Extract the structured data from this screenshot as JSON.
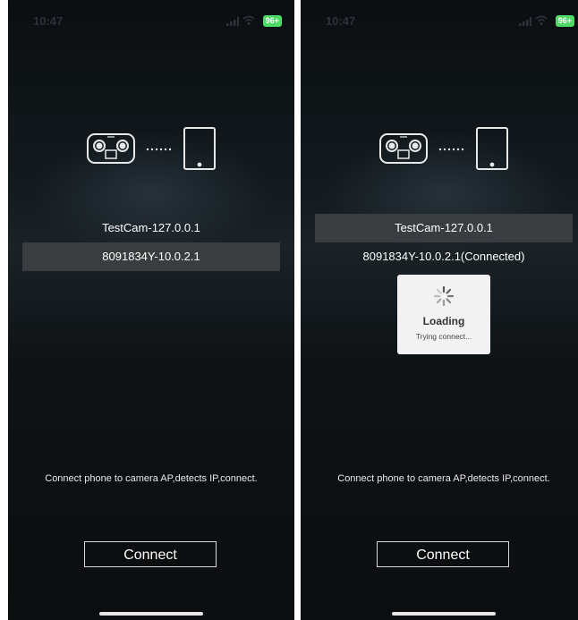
{
  "left_screen": {
    "status": {
      "time": "10:47",
      "battery": "96+"
    },
    "devices": [
      {
        "label": "TestCam-127.0.0.1",
        "selected": false
      },
      {
        "label": "8091834Y-10.0.2.1",
        "selected": true
      }
    ],
    "hint": "Connect phone to camera AP,detects IP,connect.",
    "connect_label": "Connect"
  },
  "right_screen": {
    "status": {
      "time": "10:47",
      "battery": "96+"
    },
    "devices": [
      {
        "label": "TestCam-127.0.0.1",
        "selected": true
      },
      {
        "label": "8091834Y-10.0.2.1(Connected)",
        "selected": false
      }
    ],
    "loading": {
      "title": "Loading",
      "subtitle": "Trying connect..."
    },
    "hint": "Connect phone to camera AP,detects IP,connect.",
    "connect_label": "Connect"
  },
  "icons": [
    "signal-icon",
    "wifi-icon",
    "battery-icon",
    "camera-icon",
    "tablet-icon",
    "spinner-icon"
  ],
  "colors": {
    "background": "#0f1315",
    "selected_row": "#3a3d40",
    "battery": "#4cd964",
    "loading_bg": "#f2f2f2"
  }
}
